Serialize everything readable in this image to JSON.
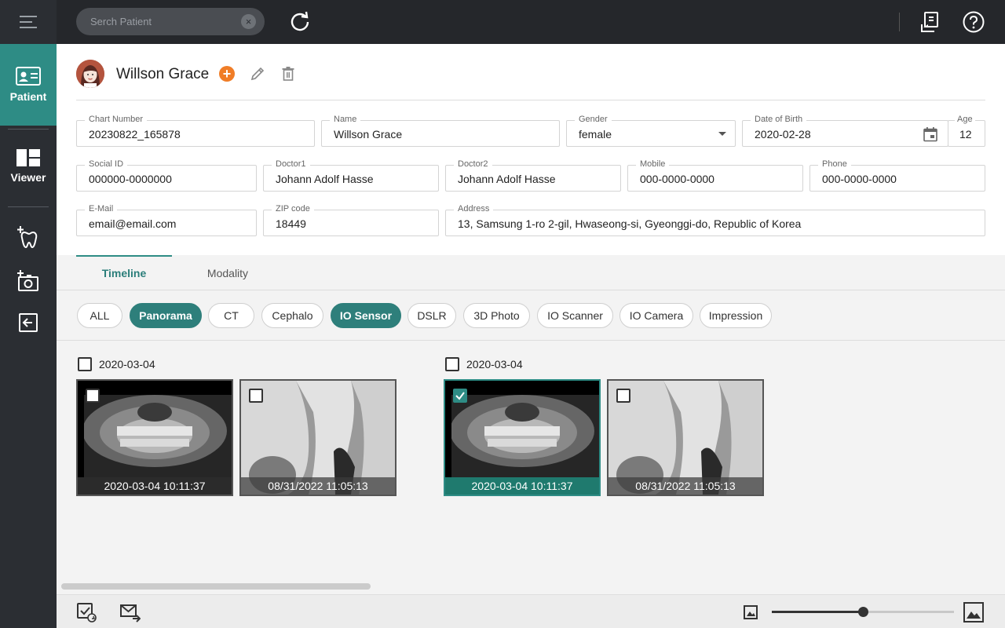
{
  "sidebar": {
    "nav": [
      {
        "label": "Patient",
        "icon": "id-card-icon",
        "active": true
      },
      {
        "label": "Viewer",
        "icon": "layout-grid-icon",
        "active": false
      }
    ]
  },
  "topbar": {
    "search_placeholder": "Serch Patient"
  },
  "patient": {
    "name": "Willson Grace",
    "fields": {
      "chart_number": {
        "label": "Chart Number",
        "value": "20230822_165878"
      },
      "name": {
        "label": "Name",
        "value": "Willson Grace"
      },
      "gender": {
        "label": "Gender",
        "value": "female"
      },
      "dob": {
        "label": "Date of Birth",
        "value": "2020-02-28"
      },
      "age": {
        "label": "Age",
        "value": "12"
      },
      "social_id": {
        "label": "Social ID",
        "value": "000000-0000000"
      },
      "doctor1": {
        "label": "Doctor1",
        "value": "Johann Adolf Hasse"
      },
      "doctor2": {
        "label": "Doctor2",
        "value": "Johann Adolf Hasse"
      },
      "mobile": {
        "label": "Mobile",
        "value": "000-0000-0000"
      },
      "phone": {
        "label": "Phone",
        "value": "000-0000-0000"
      },
      "email": {
        "label": "E-Mail",
        "value": "email@email.com"
      },
      "zip": {
        "label": "ZIP code",
        "value": "18449"
      },
      "address": {
        "label": "Address",
        "value": "13, Samsung 1-ro 2-gil, Hwaseong-si, Gyeonggi-do, Republic of Korea"
      }
    }
  },
  "tabs": [
    {
      "label": "Timeline",
      "active": true
    },
    {
      "label": "Modality",
      "active": false
    }
  ],
  "filters": [
    {
      "label": "ALL",
      "active": false
    },
    {
      "label": "Panorama",
      "active": true
    },
    {
      "label": "CT",
      "active": false
    },
    {
      "label": "Cephalo",
      "active": false
    },
    {
      "label": "IO Sensor",
      "active": true
    },
    {
      "label": "DSLR",
      "active": false
    },
    {
      "label": "3D Photo",
      "active": false
    },
    {
      "label": "IO Scanner",
      "active": false
    },
    {
      "label": "IO Camera",
      "active": false
    },
    {
      "label": "Impression",
      "active": false
    }
  ],
  "timeline": {
    "groups": [
      {
        "date": "2020-03-04",
        "checked": false,
        "images": [
          {
            "kind": "panorama",
            "caption": "2020-03-04 10:11:37",
            "checked": false,
            "selected": false
          },
          {
            "kind": "io-sensor",
            "caption": "08/31/2022 11:05:13",
            "checked": false,
            "selected": false
          }
        ]
      },
      {
        "date": "2020-03-04",
        "checked": false,
        "images": [
          {
            "kind": "panorama",
            "caption": "2020-03-04 10:11:37",
            "checked": true,
            "selected": true
          },
          {
            "kind": "io-sensor",
            "caption": "08/31/2022 11:05:13",
            "checked": false,
            "selected": false
          }
        ]
      }
    ]
  },
  "zoom": {
    "level": 0.5
  },
  "colors": {
    "accent": "#2e8c85",
    "sidebar_bg": "#2b2e33",
    "topbar_bg": "#25272b",
    "add_button": "#f07d27"
  }
}
